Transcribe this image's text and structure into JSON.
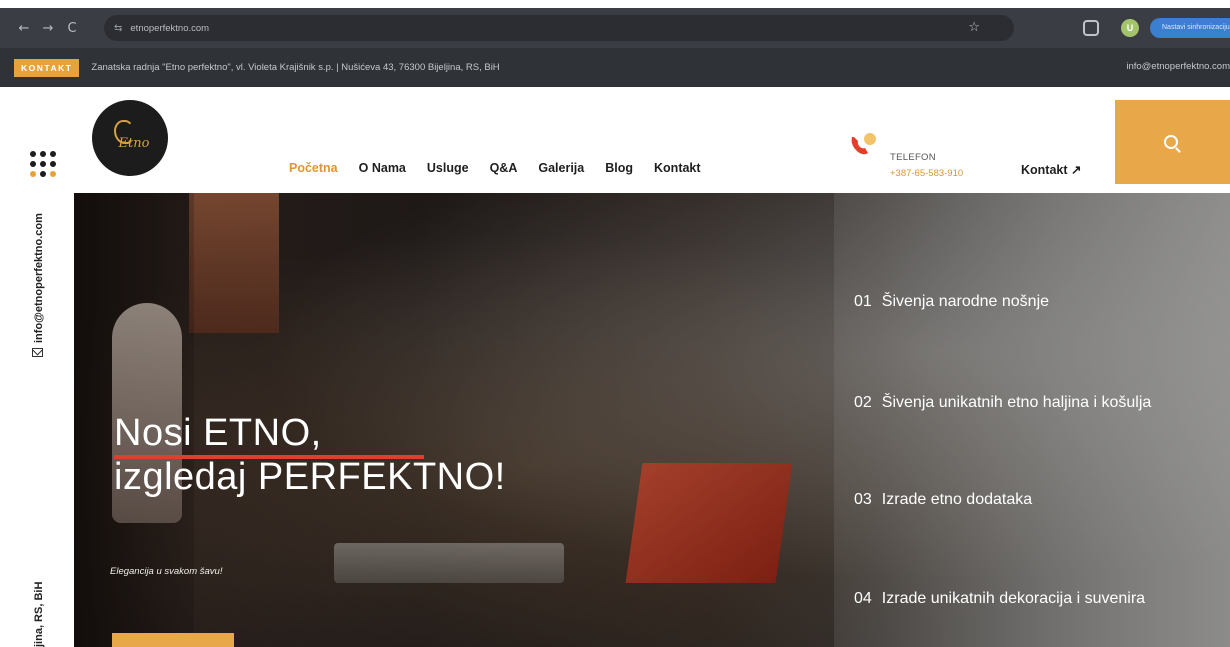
{
  "browser": {
    "back": "←",
    "forward": "→",
    "reload": "C",
    "tune": "⇆",
    "url": "etnoperfektno.com",
    "star": "☆",
    "profile_initial": "U",
    "sync_label": "Nastavi sinhronizaciju"
  },
  "infobar": {
    "tag": "KONTAKT",
    "address": "Zanatska radnja \"Etno perfektno\", vl. Violeta Krajišnik s.p. | Nušićeva 43, 76300 Bijeljina, RS, BiH",
    "email": "info@etnoperfektno.com"
  },
  "header": {
    "logo_text": "Etno",
    "nav": [
      "Početna",
      "O Nama",
      "Usluge",
      "Q&A",
      "Galerija",
      "Blog",
      "Kontakt"
    ],
    "active_nav_index": 0,
    "phone_label": "TELEFON",
    "phone_number": "+387-65-583-910",
    "kontakt_link": "Kontakt ↗"
  },
  "side": {
    "email": "info@etnoperfektno.com",
    "location": "jina, RS, BiH"
  },
  "hero": {
    "title_line1": "Nosi ETNO,",
    "title_line2": "izgledaj PERFEKTNO!",
    "subtitle": "Elegancija u svakom šavu!",
    "services": [
      {
        "num": "01",
        "label": "Šivenja narodne nošnje"
      },
      {
        "num": "02",
        "label": "Šivenja unikatnih etno haljina i košulja"
      },
      {
        "num": "03",
        "label": "Izrade etno dodataka"
      },
      {
        "num": "04",
        "label": "Izrade unikatnih dekoracija i suvenira"
      }
    ]
  },
  "colors": {
    "accent": "#e8a23a",
    "dark_bar": "#2f3237",
    "hero_underline": "#e0402a"
  }
}
